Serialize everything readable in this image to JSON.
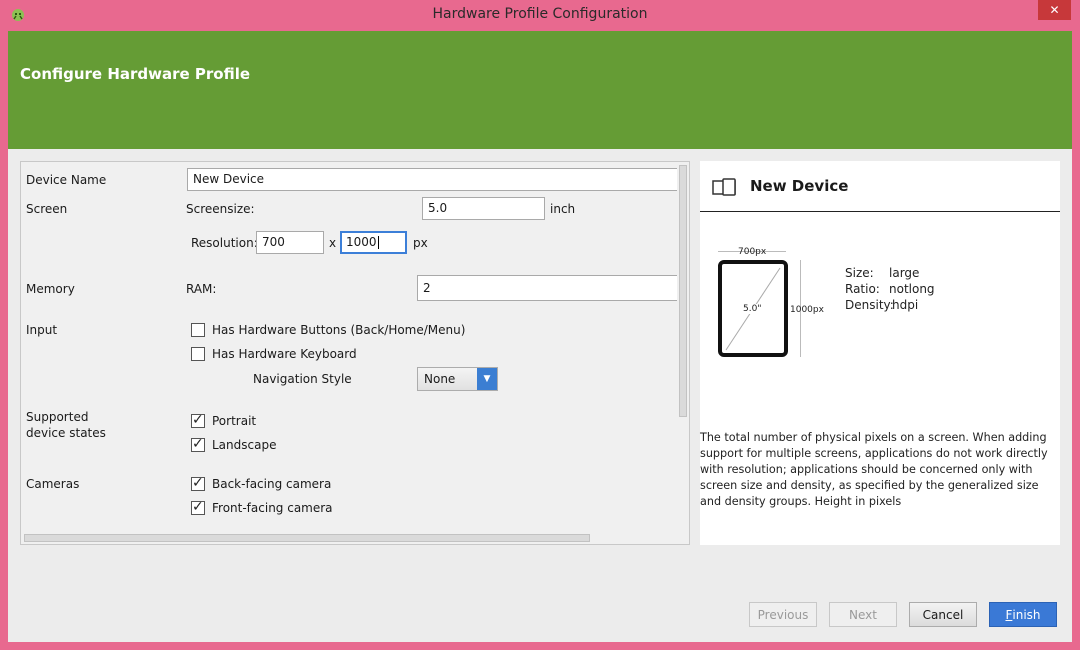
{
  "window": {
    "title": "Hardware Profile Configuration",
    "close_glyph": "✕"
  },
  "header": {
    "title": "Configure Hardware Profile",
    "color": "#659c35"
  },
  "form": {
    "device_name": {
      "label": "Device Name",
      "value": "New Device"
    },
    "screen": {
      "label": "Screen",
      "screensize_label": "Screensize:",
      "screensize_value": "5.0",
      "screensize_unit": "inch",
      "resolution_label": "Resolution:",
      "width_value": "700",
      "times": "x",
      "height_value": "1000",
      "resolution_unit": "px"
    },
    "memory": {
      "label": "Memory",
      "ram_label": "RAM:",
      "ram_value": "2"
    },
    "input": {
      "label": "Input",
      "hardware_buttons": {
        "label": "Has Hardware Buttons (Back/Home/Menu)",
        "checked": false
      },
      "hardware_keyboard": {
        "label": "Has Hardware Keyboard",
        "checked": false
      },
      "navigation_label": "Navigation Style",
      "navigation_value": "None"
    },
    "device_states": {
      "label_line1": "Supported",
      "label_line2": "device states",
      "portrait": {
        "label": "Portrait",
        "checked": true
      },
      "landscape": {
        "label": "Landscape",
        "checked": true
      }
    },
    "cameras": {
      "label": "Cameras",
      "back": {
        "label": "Back-facing camera",
        "checked": true
      },
      "front": {
        "label": "Front-facing camera",
        "checked": true
      }
    }
  },
  "preview": {
    "title": "New Device",
    "width_label": "700px",
    "height_label": "1000px",
    "diagonal_label": "5.0\"",
    "size_label": "Size:",
    "size_value": "large",
    "ratio_label": "Ratio:",
    "ratio_value": "notlong",
    "density_label": "Density:",
    "density_value": "hdpi",
    "description": "The total number of physical pixels on a screen. When adding support for multiple screens, applications do not work directly with resolution; applications should be concerned only with screen size and density, as specified by the generalized size and density groups. Height in pixels"
  },
  "buttons": {
    "previous": "Previous",
    "next": "Next",
    "cancel": "Cancel",
    "finish_first": "F",
    "finish_rest": "inish"
  },
  "icons": [
    "android-icon",
    "close-icon",
    "device-icon",
    "check-icon",
    "chevron-down-icon"
  ]
}
